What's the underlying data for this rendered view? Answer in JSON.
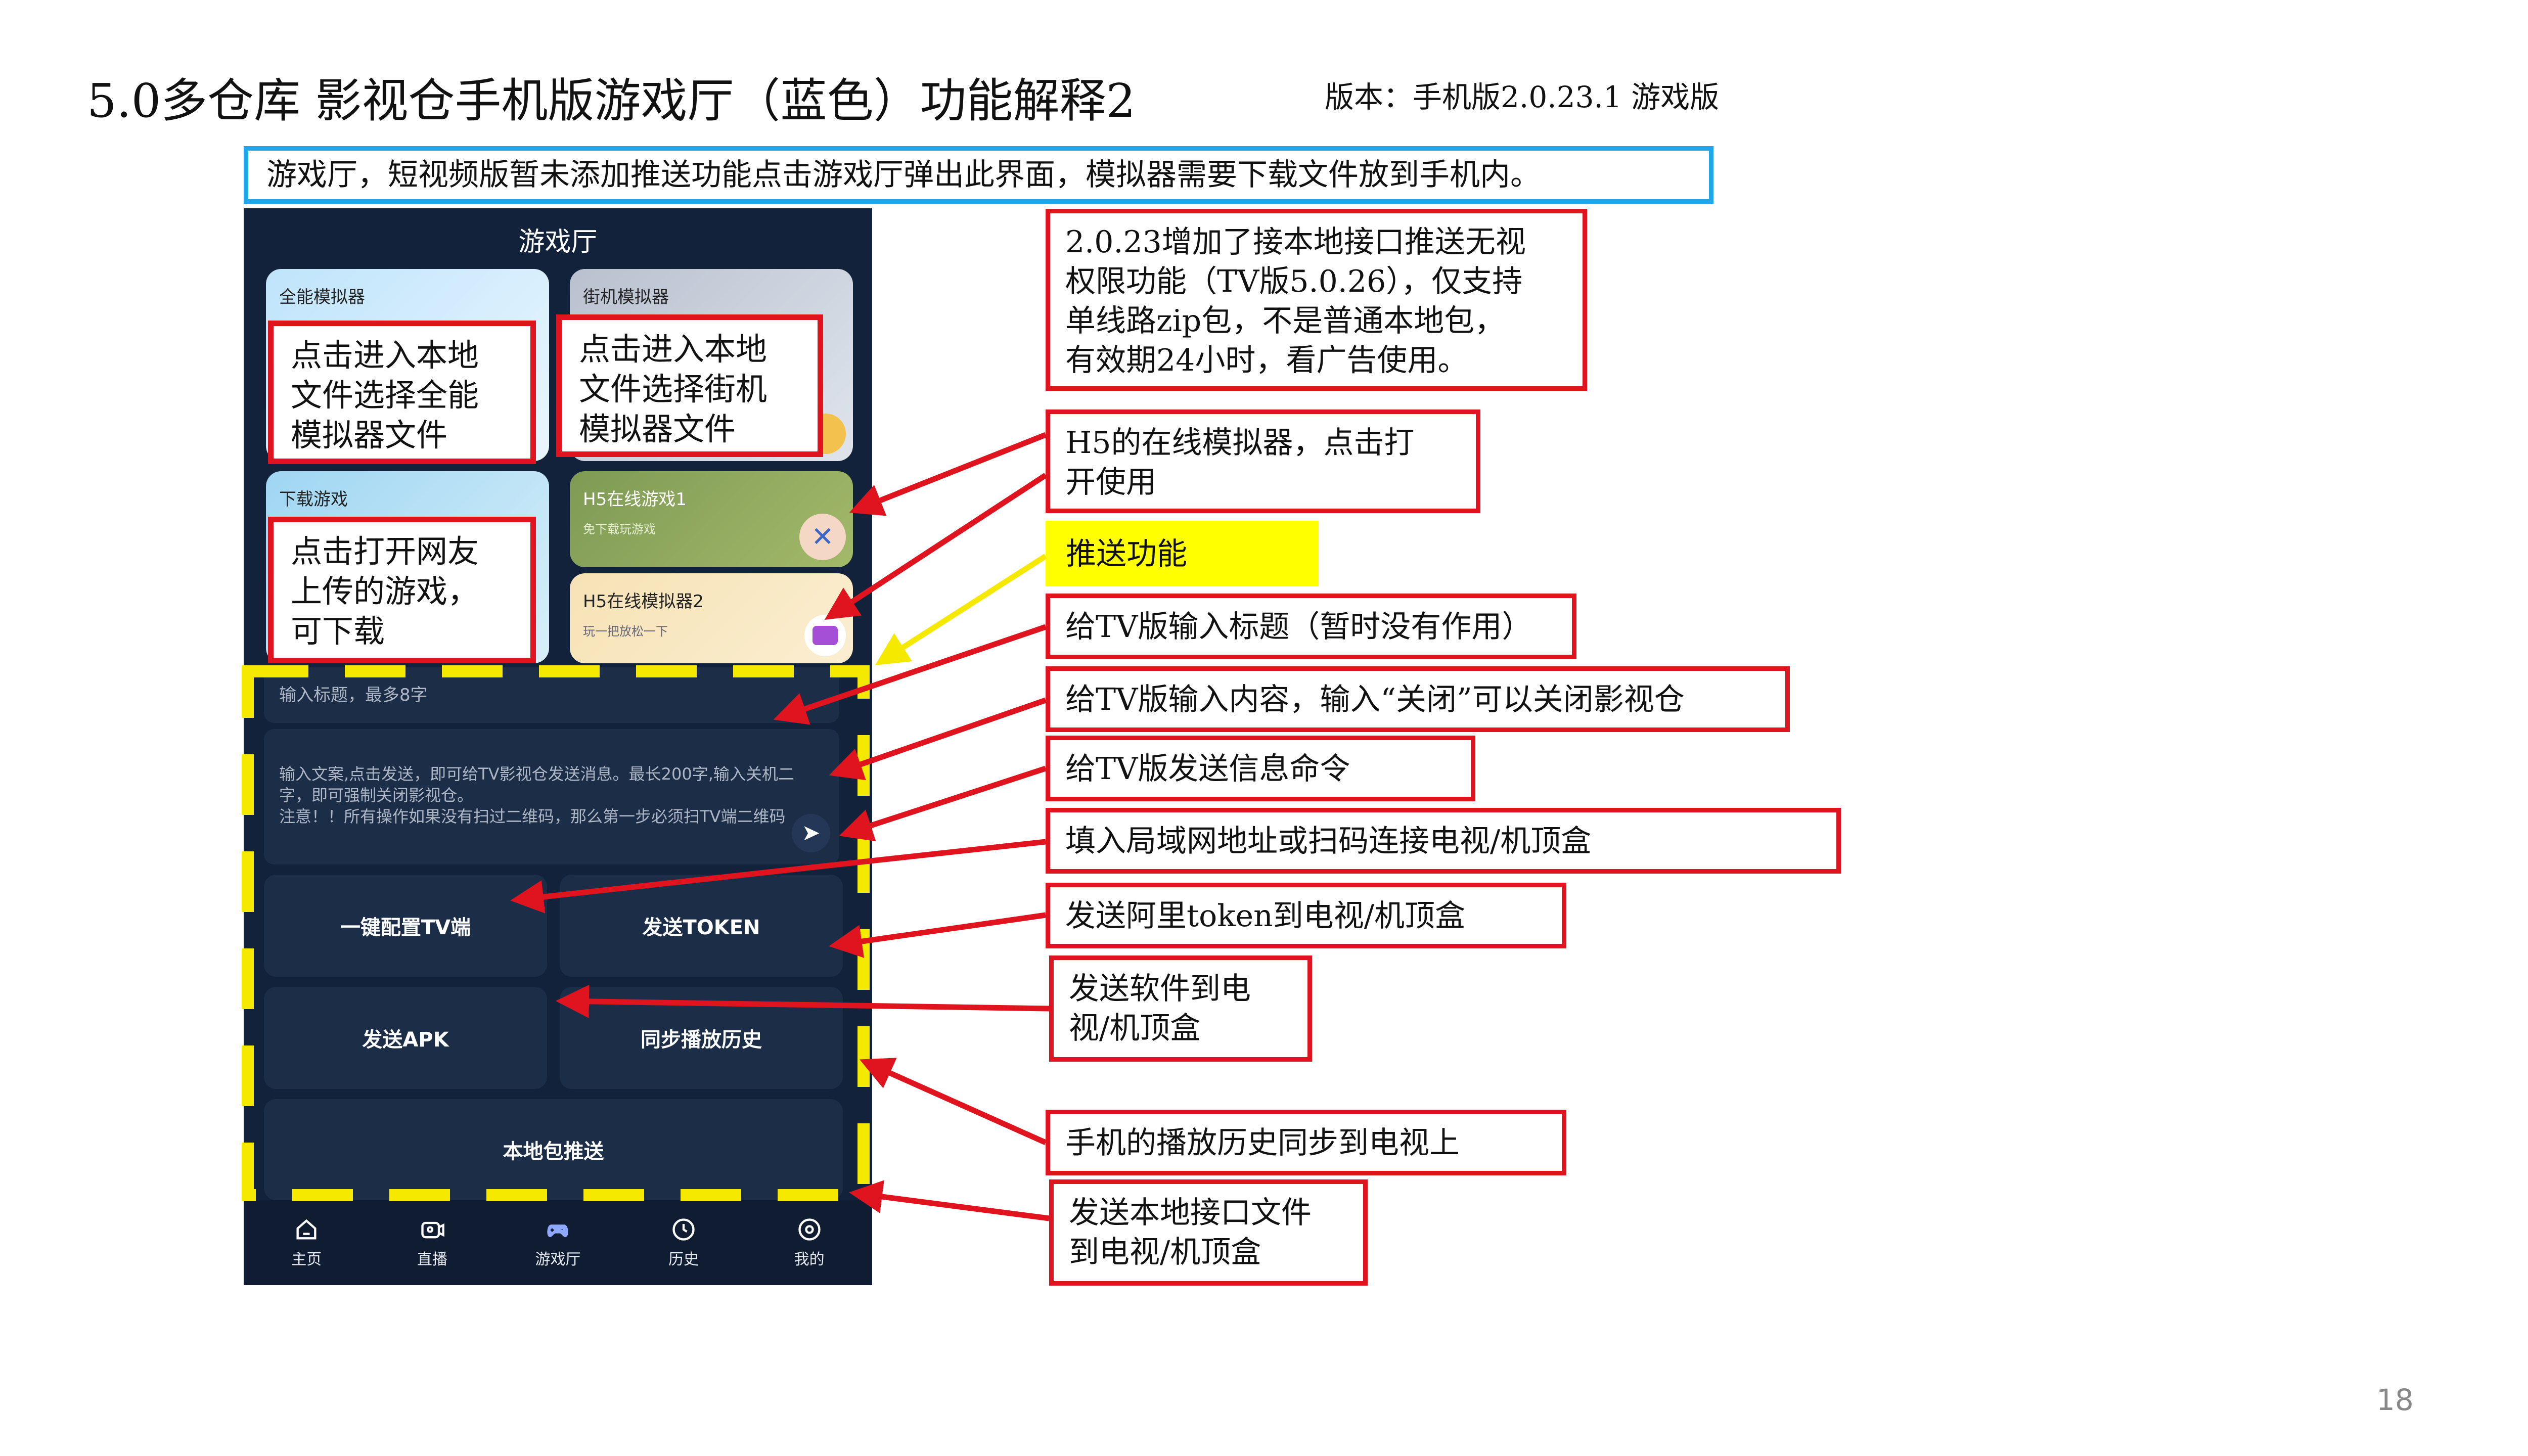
{
  "slide": {
    "title": "5.0多仓库 影视仓手机版游戏厅（蓝色）功能解释2",
    "version": "版本：手机版2.0.23.1 游戏版",
    "page_number": "18",
    "blue_note": "游戏厅，短视频版暂未添加推送功能点击游戏厅弹出此界面，模拟器需要下载文件放到手机内。"
  },
  "phone": {
    "header_title": "游戏厅",
    "cards": {
      "all_emulator": "全能模拟器",
      "arcade_emulator": "街机模拟器",
      "download_games": "下载游戏",
      "h5_game1": "H5在线游戏1",
      "h5_game1_sub": "免下载玩游戏",
      "h5_emulator2": "H5在线模拟器2",
      "h5_emulator2_sub": "玩一把放松一下"
    },
    "labels": {
      "all_emulator": "点击进入本地\n文件选择全能\n模拟器文件",
      "arcade_emulator": "点击进入本地\n文件选择街机\n模拟器文件",
      "download_games": "点击打开网友\n上传的游戏，\n可下载"
    },
    "title_input_placeholder": "输入标题，最多8字",
    "content_textarea_placeholder": "输入文案,点击发送，即可给TV影视仓发送消息。最长200字,输入关机二字，即可强制关闭影视仓。\n注意！！所有操作如果没有扫过二维码，那么第一步必须扫TV端二维码",
    "buttons": {
      "config_tv": "一键配置TV端",
      "send_token": "发送TOKEN",
      "send_apk": "发送APK",
      "sync_history": "同步播放历史",
      "local_push": "本地包推送"
    },
    "tabs": [
      "主页",
      "直播",
      "游戏厅",
      "历史",
      "我的"
    ]
  },
  "annotations": {
    "local_api_push": "2.0.23增加了接本地接口推送无视\n权限功能（TV版5.0.26），仅支持\n单线路zip包，不是普通本地包，\n有效期24小时，看广告使用。",
    "h5_emulator": "H5的在线模拟器，点击打\n开使用",
    "push_feature": "推送功能",
    "tv_title": "给TV版输入标题（暂时没有作用）",
    "tv_content": "给TV版输入内容，输入“关闭”可以关闭影视仓",
    "tv_send": "给TV版发送信息命令",
    "lan_address": "填入局域网地址或扫码连接电视/机顶盒",
    "send_token": "发送阿里token到电视/机顶盒",
    "send_apk": "发送软件到电\n视/机顶盒",
    "sync_history": "手机的播放历史同步到电视上",
    "send_local_api": "发送本地接口文件\n到电视/机顶盒"
  },
  "colors": {
    "annotation_border": "#e0141e",
    "note_border": "#20a7e8",
    "highlight_fill": "#ffff00",
    "dashed_frame": "#f5e900",
    "phone_bg": "#12223a"
  }
}
